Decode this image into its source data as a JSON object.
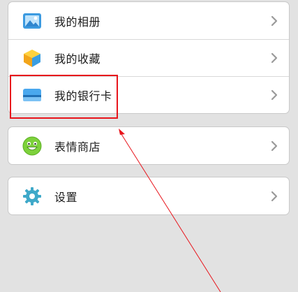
{
  "menu": {
    "group1": [
      {
        "label": "我的相册",
        "icon": "photo-album-icon"
      },
      {
        "label": "我的收藏",
        "icon": "favorites-cube-icon"
      },
      {
        "label": "我的银行卡",
        "icon": "bank-card-icon"
      }
    ],
    "group2": [
      {
        "label": "表情商店",
        "icon": "smiley-face-icon"
      }
    ],
    "group3": [
      {
        "label": "设置",
        "icon": "gear-icon"
      }
    ]
  },
  "annotation": {
    "highlight_color": "#e8151c",
    "highlighted_item": "我的银行卡"
  }
}
